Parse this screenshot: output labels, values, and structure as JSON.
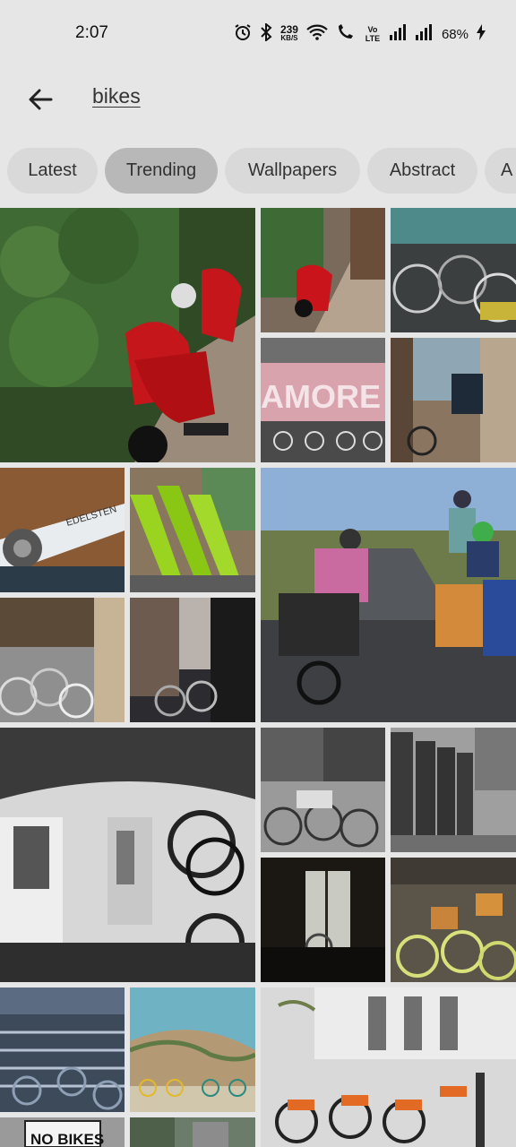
{
  "status_bar": {
    "time": "2:07",
    "network_speed_value": "239",
    "network_speed_unit": "KB/S",
    "volte_label": "Vo LTE",
    "battery": "68%",
    "icons": [
      "alarm-icon",
      "bluetooth-icon",
      "wifi-icon",
      "wifi-call-icon",
      "signal-icon",
      "signal-icon-2",
      "charging-icon"
    ]
  },
  "header": {
    "search_query": "bikes",
    "back_icon": "arrow-left-icon"
  },
  "chips": [
    {
      "label": "Latest"
    },
    {
      "label": "Trending",
      "selected": true
    },
    {
      "label": "Wallpapers"
    },
    {
      "label": "Abstract"
    },
    {
      "label": "A"
    }
  ],
  "grid": {
    "images": [
      {
        "subject": "red scooters on cobblestone street with ivy"
      },
      {
        "subject": "red scooters in alley"
      },
      {
        "subject": "parked bicycles"
      },
      {
        "subject": "AMORE wall with bikes",
        "text": "AMORE"
      },
      {
        "subject": "bicycle by a fence"
      },
      {
        "subject": "bicycle gear closeup",
        "text": "EDELSTEN"
      },
      {
        "subject": "green rental bikes"
      },
      {
        "subject": "family cycling on a country road"
      },
      {
        "subject": "bike rack on street"
      },
      {
        "subject": "city street with bikes"
      },
      {
        "subject": "bikes hanging inside a train"
      },
      {
        "subject": "bikes in front of building"
      },
      {
        "subject": "telephone booths and bikes"
      },
      {
        "subject": "window with bicycle"
      },
      {
        "subject": "yellow bikes with baskets"
      },
      {
        "subject": "bike parking rows"
      },
      {
        "subject": "bicycles on a dune"
      },
      {
        "subject": "orange rental bike station"
      },
      {
        "subject": "no bikes sign",
        "text": "NO BIKES"
      },
      {
        "subject": "street bikes"
      },
      {
        "subject": "dark street"
      }
    ]
  }
}
